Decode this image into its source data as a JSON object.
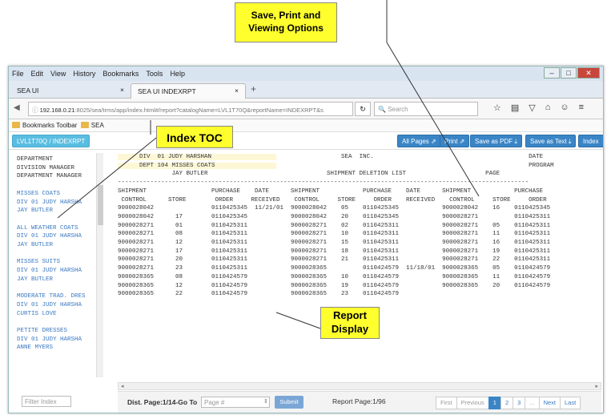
{
  "callouts": {
    "save": "Save, Print and\nViewing  Options",
    "index": "Index TOC",
    "report": "Report\nDisplay"
  },
  "menubar": {
    "items": [
      "File",
      "Edit",
      "View",
      "History",
      "Bookmarks",
      "Tools",
      "Help"
    ]
  },
  "tabs": [
    {
      "label": "SEA UI"
    },
    {
      "label": "SEA UI INDEXRPT"
    }
  ],
  "urlbar": {
    "host": "192.168.0.21",
    "path": ":8025/sea/trms/app/index.html#/report?catalogName=LVL1T70Q&reportName=INDEXRPT&s",
    "search_placeholder": "Search"
  },
  "bookmarks": {
    "toolbar": "Bookmarks Toolbar",
    "folder": "SEA"
  },
  "apptool": {
    "catalog": "LVL1T70Q / INDEXRPT",
    "all_pages": "All Pages ⇗",
    "print": "Print ⇗",
    "save_pdf": "Save as PDF ⤓",
    "save_text": "Save as Text ⤓",
    "index": "Index"
  },
  "toc": [
    {
      "t": "DEPARTMENT",
      "k": "blk"
    },
    {
      "t": "DIVISION MANAGER",
      "k": "blk"
    },
    {
      "t": "DEPARTMENT MANAGER",
      "k": "blk"
    },
    {
      "t": "",
      "k": "gap"
    },
    {
      "t": "MISSES COATS",
      "k": "lnk"
    },
    {
      "t": "DIV  01 JUDY HARSHA",
      "k": "lnk"
    },
    {
      "t": "JAY BUTLER",
      "k": "lnk"
    },
    {
      "t": "",
      "k": "gap"
    },
    {
      "t": "ALL WEATHER COATS",
      "k": "lnk"
    },
    {
      "t": "DIV  01 JUDY HARSHA",
      "k": "lnk"
    },
    {
      "t": "JAY BUTLER",
      "k": "lnk"
    },
    {
      "t": "",
      "k": "gap"
    },
    {
      "t": "MISSES SUITS",
      "k": "lnk"
    },
    {
      "t": "DIV  01 JUDY HARSHA",
      "k": "lnk"
    },
    {
      "t": "JAY BUTLER",
      "k": "lnk"
    },
    {
      "t": "",
      "k": "gap"
    },
    {
      "t": "MODERATE TRAD. DRES",
      "k": "lnk"
    },
    {
      "t": "DIV  01 JUDY HARSHA",
      "k": "lnk"
    },
    {
      "t": "CURTIS LOVE",
      "k": "lnk"
    },
    {
      "t": "",
      "k": "gap"
    },
    {
      "t": "PETITE DRESSES",
      "k": "lnk"
    },
    {
      "t": "DIV  01 JUDY HARSHA",
      "k": "lnk"
    },
    {
      "t": "ANNE MYERS",
      "k": "lnk"
    }
  ],
  "filter_placeholder": "Filter Index",
  "report": {
    "header": [
      {
        "hl": "      DIV  01 JUDY HARSHAN                  ",
        "rest": "                  SEA  INC.                                           DATE"
      },
      {
        "hl": "      DEPT 104 MISSES COATS                 ",
        "rest": "                                                                      PROGRAM"
      },
      {
        "hl": "",
        "rest": "               JAY BUTLER                                 SHIPMENT DELETION LIST                      PAGE"
      }
    ],
    "lines": [
      "------------------------------------------------------------------------------------------------------------------",
      "SHIPMENT                  PURCHASE    DATE      SHIPMENT            PURCHASE    DATE      SHIPMENT            PURCHASE",
      " CONTROL      STORE        ORDER     RECEIVED    CONTROL     STORE     ORDER    RECEIVED    CONTROL     STORE     ORDER",
      "9000028042                0110425345  11/21/01  9000028042    05    0110425345            9000028042    16    0110425345",
      "9000028042      17        0110425345            9000028042    20    0110425345            9000028271          0110425311",
      "9000028271      01        0110425311            9000028271    02    0110425311            9000028271    05    0110425311",
      "9000028271      08        0110425311            9000028271    10    0110425311            9000028271    11    0110425311",
      "9000028271      12        0110425311            9000028271    15    0110425311            9000028271    16    0110425311",
      "9000028271      17        0110425311            9000028271    18    0110425311            9000028271    19    0110425311",
      "9000028271      20        0110425311            9000028271    21    0110425311            9000028271    22    0110425311",
      "9000028271      23        0110425311            9000028365          0110424579  11/18/01  9000028365    05    0110424579",
      "9000028365      08        0110424579            9000028365    10    0110424579            9000028365    11    0110424579",
      "9000028365      12        0110424579            9000028365    19    0110424579            9000028365    20    0110424579",
      "9000028365      22        0110424579            9000028365    23    0110424579"
    ]
  },
  "footer": {
    "label": "Dist. Page:1/14-Go To",
    "placeholder": "Page #",
    "submit": "Submit",
    "pagecount": "Report Page:1/96",
    "pager": [
      "First",
      "Previous",
      "1",
      "2",
      "3",
      "...",
      "Next",
      "Last"
    ]
  }
}
